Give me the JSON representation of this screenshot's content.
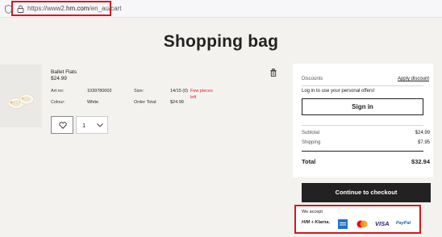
{
  "browser": {
    "url_prefix": "https://www2.",
    "url_domain": "hm.com",
    "url_path": "/en_au/cart"
  },
  "page": {
    "title": "Shopping bag"
  },
  "product": {
    "name": "Ballet Flats",
    "price": "$24.99",
    "art_no_label": "Art no:",
    "art_no": "1039780002",
    "colour_label": "Colour:",
    "colour": "White",
    "size_label": "Size:",
    "size": "14/15 (0)",
    "stock_warning": "Few pieces left",
    "order_total_label": "Order Total:",
    "order_total": "$24.99",
    "quantity": "1"
  },
  "summary": {
    "discounts_label": "Discounts",
    "apply_discount": "Apply discount",
    "login_prompt": "Log in to use your personal offers!",
    "sign_in": "Sign in",
    "subtotal_label": "Subtotal",
    "subtotal": "$24.99",
    "shipping_label": "Shipping",
    "shipping": "$7.95",
    "total_label": "Total",
    "total": "$32.94",
    "checkout": "Continue to checkout"
  },
  "payments": {
    "label": "We accept",
    "methods": [
      "H/M + Klarna.",
      "AMEX",
      "Mastercard",
      "VISA",
      "PayPal"
    ]
  },
  "colors": {
    "highlight": "#d8151f",
    "warning": "#e0182d",
    "background": "#f4f2ef",
    "button": "#222222"
  }
}
